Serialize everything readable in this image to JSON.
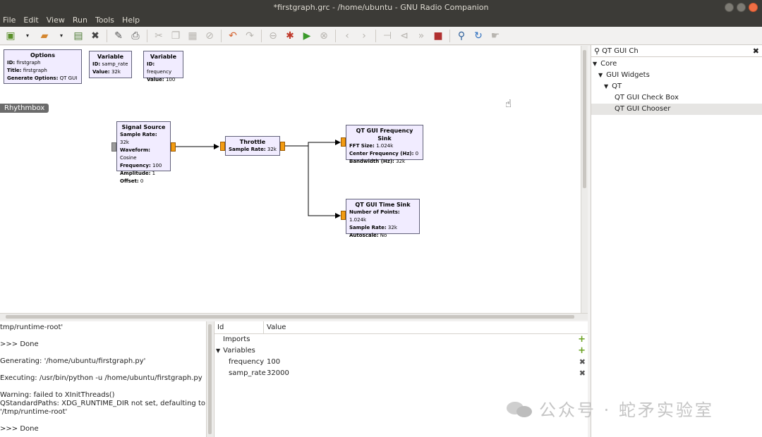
{
  "window": {
    "title": "*firstgraph.grc - /home/ubuntu - GNU Radio Companion"
  },
  "menu": [
    "File",
    "Edit",
    "View",
    "Run",
    "Tools",
    "Help"
  ],
  "toolbar": {
    "icons": [
      "new-icon",
      "open-icon",
      "save-icon",
      "close-icon",
      "edit-icon",
      "print-icon",
      "cut-icon",
      "copy-icon",
      "paste-icon",
      "delete-icon",
      "undo-icon",
      "redo-icon",
      "disable-icon",
      "generate-icon",
      "run-icon",
      "stop-icon",
      "rotate-left-icon",
      "rotate-right-icon",
      "kill-icon",
      "find-icon",
      "reload-icon"
    ]
  },
  "canvas": {
    "tooltip": "Rhythmbox",
    "blocks": {
      "options": {
        "title": "Options",
        "rows": [
          [
            "ID:",
            "firstgraph"
          ],
          [
            "Title:",
            "firstgraph"
          ],
          [
            "Generate Options:",
            "QT GUI"
          ]
        ]
      },
      "var1": {
        "title": "Variable",
        "rows": [
          [
            "ID:",
            "samp_rate"
          ],
          [
            "Value:",
            "32k"
          ]
        ]
      },
      "var2": {
        "title": "Variable",
        "rows": [
          [
            "ID:",
            "frequency"
          ],
          [
            "Value:",
            "100"
          ]
        ]
      },
      "signal": {
        "title": "Signal Source",
        "rows": [
          [
            "Sample Rate:",
            "32k"
          ],
          [
            "Waveform:",
            "Cosine"
          ],
          [
            "Frequency:",
            "100"
          ],
          [
            "Amplitude:",
            "1"
          ],
          [
            "Offset:",
            "0"
          ]
        ]
      },
      "throttle": {
        "title": "Throttle",
        "rows": [
          [
            "Sample Rate:",
            "32k"
          ]
        ]
      },
      "freqsink": {
        "title": "QT GUI Frequency Sink",
        "rows": [
          [
            "FFT Size:",
            "1.024k"
          ],
          [
            "Center Frequency (Hz):",
            "0"
          ],
          [
            "Bandwidth (Hz):",
            "32k"
          ]
        ]
      },
      "timesink": {
        "title": "QT GUI Time Sink",
        "rows": [
          [
            "Number of Points:",
            "1.024k"
          ],
          [
            "Sample Rate:",
            "32k"
          ],
          [
            "Autoscale:",
            "No"
          ]
        ]
      }
    }
  },
  "search": {
    "value": "QT GUI Ch"
  },
  "tree": [
    {
      "label": "Core",
      "arrow": "▼",
      "indent": 0
    },
    {
      "label": "GUI Widgets",
      "arrow": "▼",
      "indent": 1
    },
    {
      "label": "QT",
      "arrow": "▼",
      "indent": 2
    },
    {
      "label": "QT GUI Check Box",
      "arrow": "",
      "indent": 3
    },
    {
      "label": "QT GUI Chooser",
      "arrow": "",
      "indent": 3,
      "selected": true
    }
  ],
  "console": [
    "tmp/runtime-root'",
    "",
    ">>> Done",
    "",
    "Generating: '/home/ubuntu/firstgraph.py'",
    "",
    "Executing: /usr/bin/python -u /home/ubuntu/firstgraph.py",
    "",
    "Warning: failed to XInitThreads()",
    "QStandardPaths: XDG_RUNTIME_DIR not set, defaulting to '/tmp/runtime-root'",
    "",
    ">>> Done"
  ],
  "variables": {
    "header": {
      "id": "Id",
      "value": "Value"
    },
    "rows": [
      {
        "id": "Imports",
        "value": "",
        "action": "+",
        "indent": 1
      },
      {
        "id": "Variables",
        "value": "",
        "action": "+",
        "indent": 0,
        "arrow": "▼"
      },
      {
        "id": "frequency",
        "value": "100",
        "action": "✖",
        "indent": 2
      },
      {
        "id": "samp_rate",
        "value": "32000",
        "action": "✖",
        "indent": 2
      }
    ]
  },
  "watermark": {
    "text": "公众号 · 蛇矛实验室"
  }
}
